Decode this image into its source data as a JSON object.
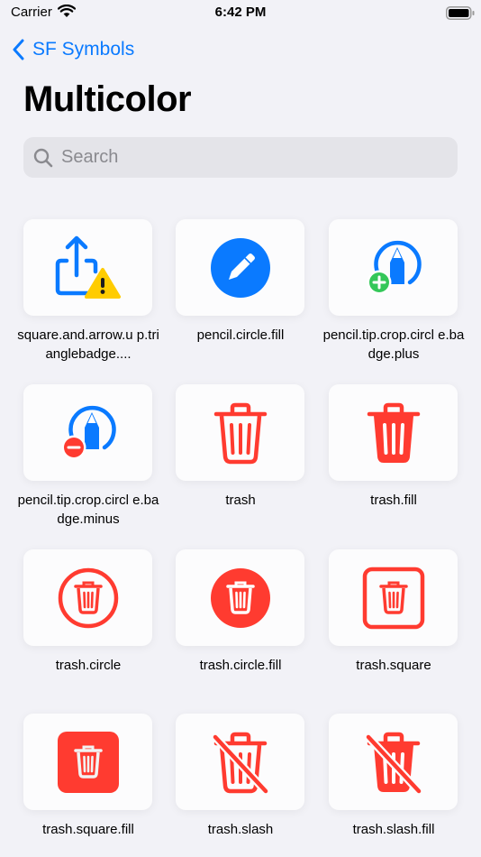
{
  "status_bar": {
    "carrier": "Carrier",
    "time": "6:42 PM"
  },
  "nav": {
    "back_label": "SF Symbols"
  },
  "title": "Multicolor",
  "search": {
    "placeholder": "Search",
    "value": ""
  },
  "colors": {
    "accent": "#0a7aff",
    "red": "#ff3b30",
    "blue": "#0a7aff",
    "yellow": "#ffcc00",
    "green": "#34c759",
    "background": "#f2f2f7"
  },
  "symbols": [
    {
      "label": "square.and.arrow.u p.trianglebadge....",
      "icon": "square-and-arrow-up-trianglebadge-icon"
    },
    {
      "label": "pencil.circle.fill",
      "icon": "pencil-circle-fill-icon"
    },
    {
      "label": "pencil.tip.crop.circl e.badge.plus",
      "icon": "pencil-tip-crop-circle-badge-plus-icon"
    },
    {
      "label": "pencil.tip.crop.circl e.badge.minus",
      "icon": "pencil-tip-crop-circle-badge-minus-icon"
    },
    {
      "label": "trash",
      "icon": "trash-icon"
    },
    {
      "label": "trash.fill",
      "icon": "trash-fill-icon"
    },
    {
      "label": "trash.circle",
      "icon": "trash-circle-icon"
    },
    {
      "label": "trash.circle.fill",
      "icon": "trash-circle-fill-icon"
    },
    {
      "label": "trash.square",
      "icon": "trash-square-icon"
    },
    {
      "label": "trash.square.fill",
      "icon": "trash-square-fill-icon"
    },
    {
      "label": "trash.slash",
      "icon": "trash-slash-icon"
    },
    {
      "label": "trash.slash.fill",
      "icon": "trash-slash-fill-icon"
    }
  ]
}
